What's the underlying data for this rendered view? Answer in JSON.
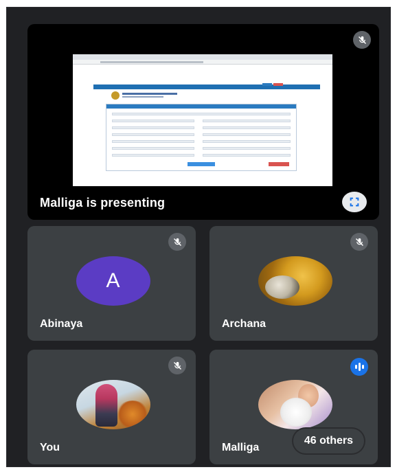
{
  "presentation": {
    "label": "Malliga is presenting",
    "fullscreen_icon": "fullscreen-icon",
    "mic_icon": "mic-off-icon"
  },
  "participants": [
    {
      "name": "Abinaya",
      "avatar_letter": "A",
      "avatar_color": "#5b3cc4",
      "mic": "muted"
    },
    {
      "name": "Archana",
      "avatar": "photo",
      "mic": "muted"
    },
    {
      "name": "You",
      "avatar": "photo",
      "mic": "muted"
    },
    {
      "name": "Malliga",
      "avatar": "photo",
      "mic": "speaking"
    }
  ],
  "others": {
    "label": "46 others"
  },
  "colors": {
    "background": "#202124",
    "tile": "#3c4043",
    "accent": "#1a73e8",
    "mute_badge": "#5f6368"
  }
}
